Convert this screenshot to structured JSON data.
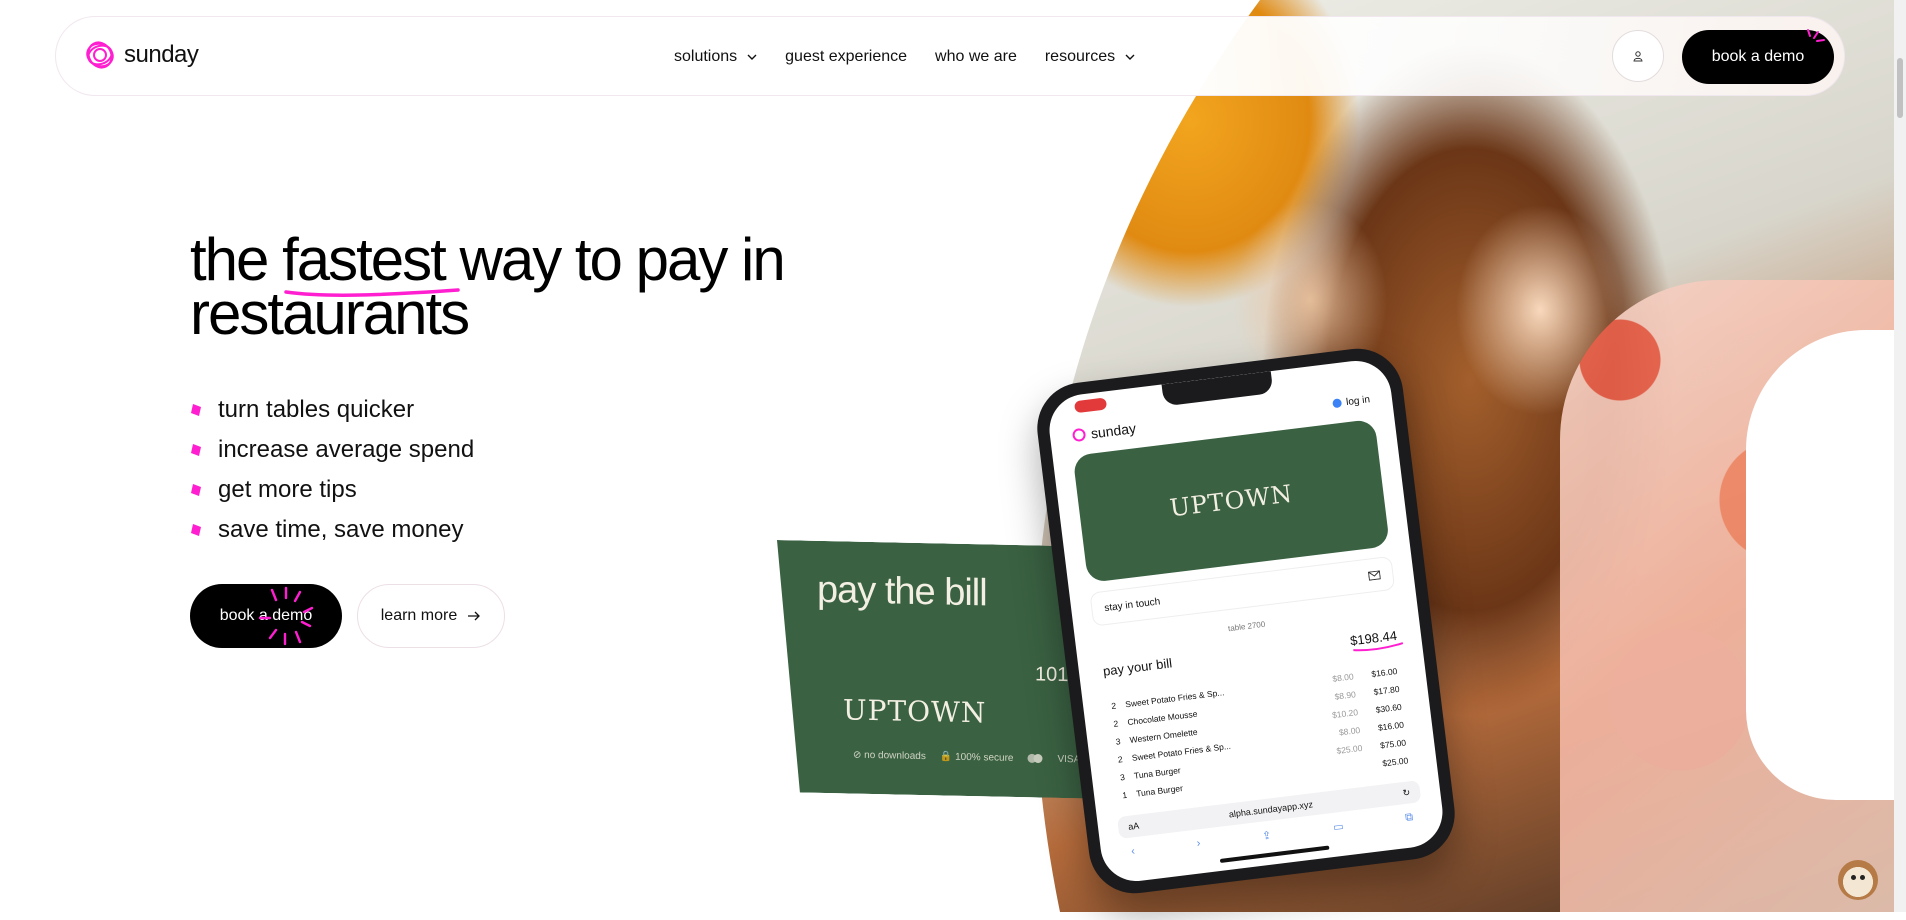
{
  "brand": {
    "name": "sunday",
    "accent": "#ff1fd1"
  },
  "nav": {
    "items": [
      {
        "label": "solutions",
        "dropdown": true
      },
      {
        "label": "guest experience",
        "dropdown": false
      },
      {
        "label": "who we are",
        "dropdown": false
      },
      {
        "label": "resources",
        "dropdown": true
      }
    ],
    "user_icon": "user-icon",
    "cta_label": "book a demo"
  },
  "hero": {
    "headline_before": "the ",
    "headline_highlight": "fastest",
    "headline_after": " way to pay in restaurants",
    "bullets": [
      "turn tables quicker",
      "increase average spend",
      "get more tips",
      "save time, save money"
    ],
    "cta_primary": "book a demo",
    "cta_secondary": "learn more"
  },
  "card": {
    "title": "pay the bill",
    "table_number": "101",
    "restaurant": "UPTOWN",
    "footer": [
      "⊘ no downloads",
      "🔒 100% secure",
      "VISA"
    ]
  },
  "phone": {
    "brand": "sunday",
    "login": "log in",
    "restaurant": "UPTOWN",
    "stay_in_touch": "stay in touch",
    "table": "table 2700",
    "pay_label": "pay your bill",
    "total": "$198.44",
    "items": [
      {
        "qty": "2",
        "name": "Sweet Potato Fries & Sp...",
        "unit": "$8.00",
        "total": "$16.00"
      },
      {
        "qty": "2",
        "name": "Chocolate Mousse",
        "unit": "$8.90",
        "total": "$17.80"
      },
      {
        "qty": "3",
        "name": "Western Omelette",
        "unit": "$10.20",
        "total": "$30.60"
      },
      {
        "qty": "2",
        "name": "Sweet Potato Fries & Sp...",
        "unit": "$8.00",
        "total": "$16.00"
      },
      {
        "qty": "3",
        "name": "Tuna Burger",
        "unit": "$25.00",
        "total": "$75.00"
      },
      {
        "qty": "1",
        "name": "Tuna Burger",
        "unit": "",
        "total": "$25.00"
      }
    ],
    "url_aa": "aA",
    "url": "alpha.sundayapp.xyz"
  }
}
